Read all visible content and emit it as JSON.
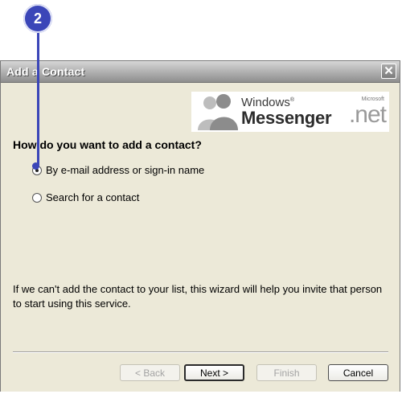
{
  "callout": {
    "number": "2"
  },
  "dialog": {
    "title": "Add a Contact",
    "close_glyph": "✕",
    "logo": {
      "windows": "Windows",
      "registered": "®",
      "messenger": "Messenger",
      "microsoft": "Microsoft",
      "net": ".net"
    },
    "question": "How do you want to add a contact?",
    "options": [
      {
        "label": "By e-mail address or sign-in name",
        "selected": true
      },
      {
        "label": "Search for a contact",
        "selected": false
      }
    ],
    "info_text": "If we can't add the contact to your list, this wizard will help you invite that person to start using this service.",
    "buttons": {
      "back": "< Back",
      "next": "Next >",
      "finish": "Finish",
      "cancel": "Cancel"
    }
  },
  "colors": {
    "callout": "#3b46b8",
    "dialog_bg": "#ece9d8",
    "titlebar": "#9a9a9a"
  }
}
